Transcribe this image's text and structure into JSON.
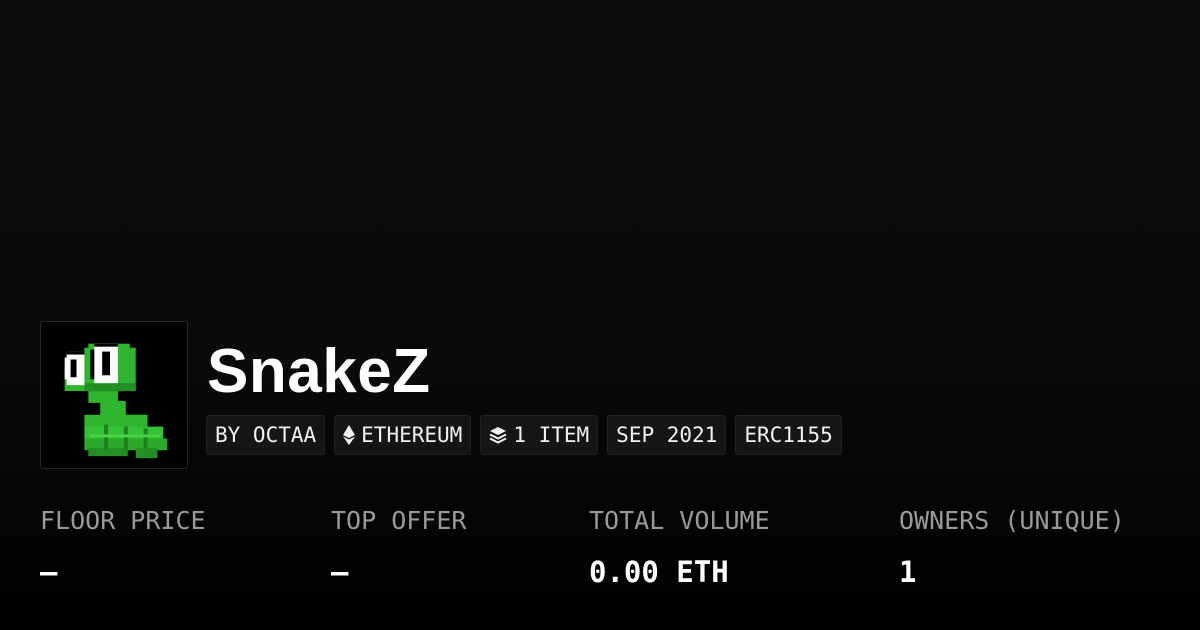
{
  "collection": {
    "name": "SnakeZ",
    "avatar_icon": "snake-icon"
  },
  "badges": [
    {
      "text": "BY OCTAA",
      "icon": ""
    },
    {
      "text": "ETHEREUM",
      "icon": "ethereum-icon"
    },
    {
      "text": "1 ITEM",
      "icon": "layers-icon"
    },
    {
      "text": "SEP 2021",
      "icon": ""
    },
    {
      "text": "ERC1155",
      "icon": ""
    }
  ],
  "stats": [
    {
      "label": "FLOOR PRICE",
      "value": "—"
    },
    {
      "label": "TOP OFFER",
      "value": "—"
    },
    {
      "label": "TOTAL VOLUME",
      "value": "0.00 ETH"
    },
    {
      "label": "OWNERS (UNIQUE)",
      "value": "1"
    }
  ],
  "colors": {
    "background": "#0b0b0b",
    "badge_bg": "#151515",
    "label": "#9a9a9a",
    "snake_green": "#2fb52f"
  }
}
